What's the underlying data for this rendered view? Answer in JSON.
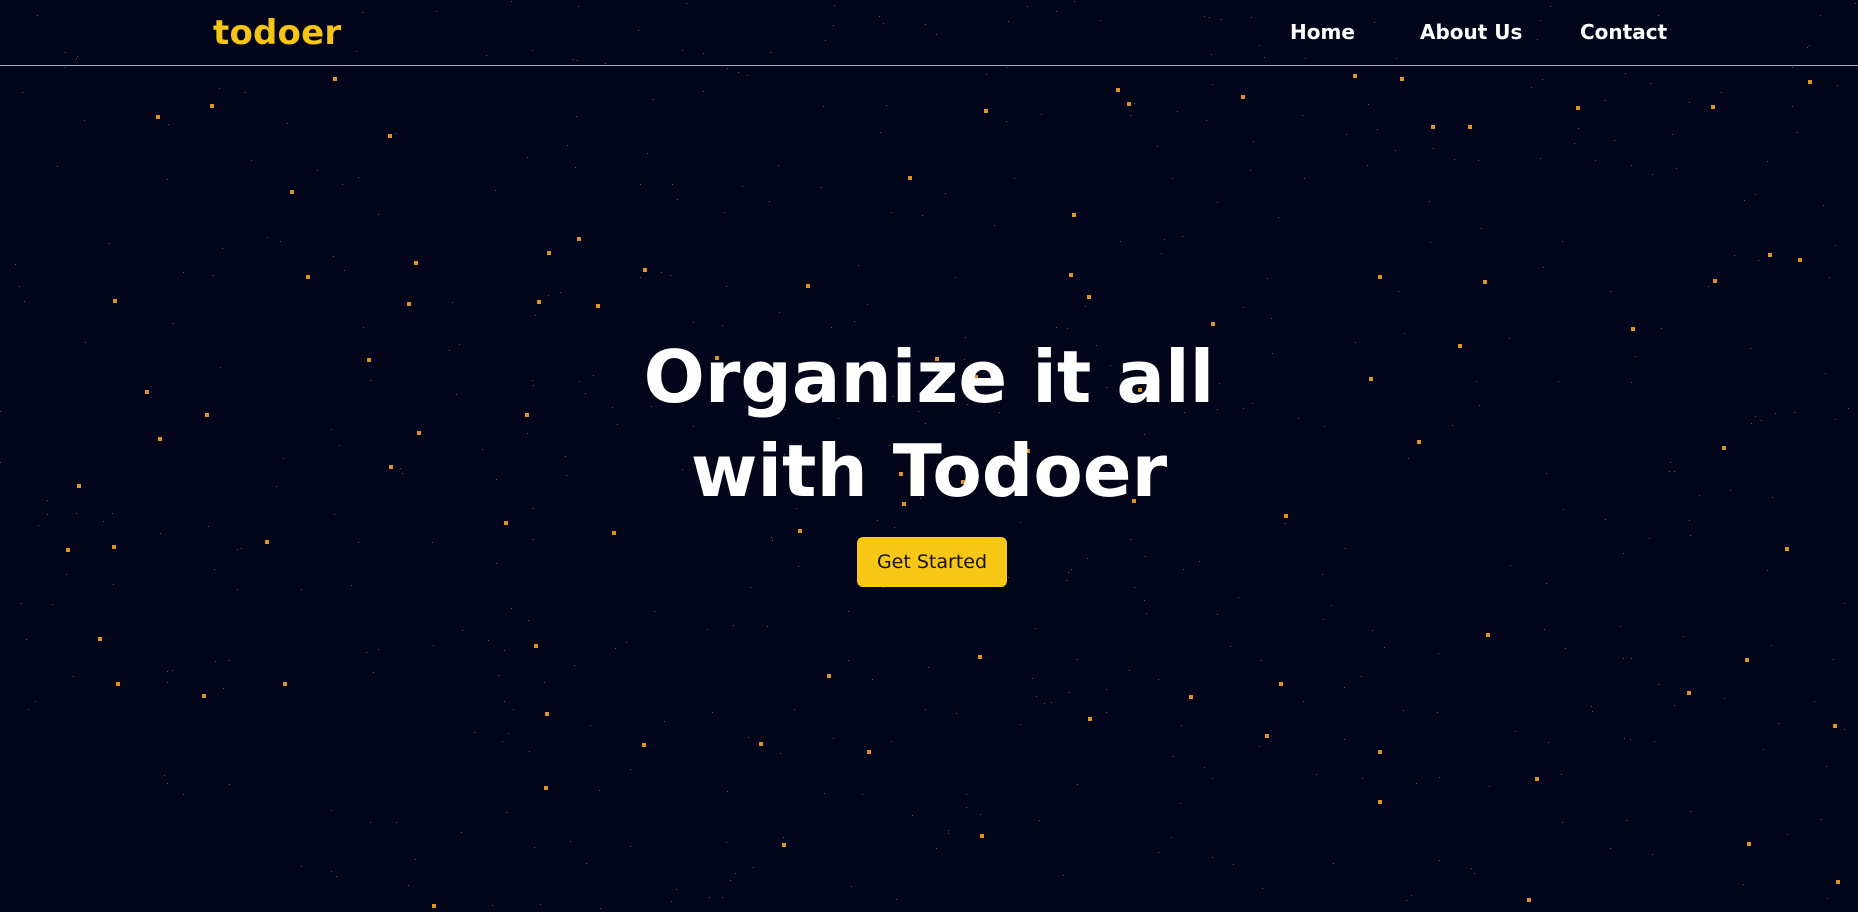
{
  "brand": {
    "logo_text": "todoer",
    "accent_color": "#f8c615",
    "background_color": "#03061a"
  },
  "nav": {
    "items": [
      {
        "label": "Home"
      },
      {
        "label": "About Us"
      },
      {
        "label": "Contact"
      }
    ]
  },
  "hero": {
    "title_line_1": "Organize it all",
    "title_line_2": "with Todoer",
    "cta_label": "Get Started"
  }
}
